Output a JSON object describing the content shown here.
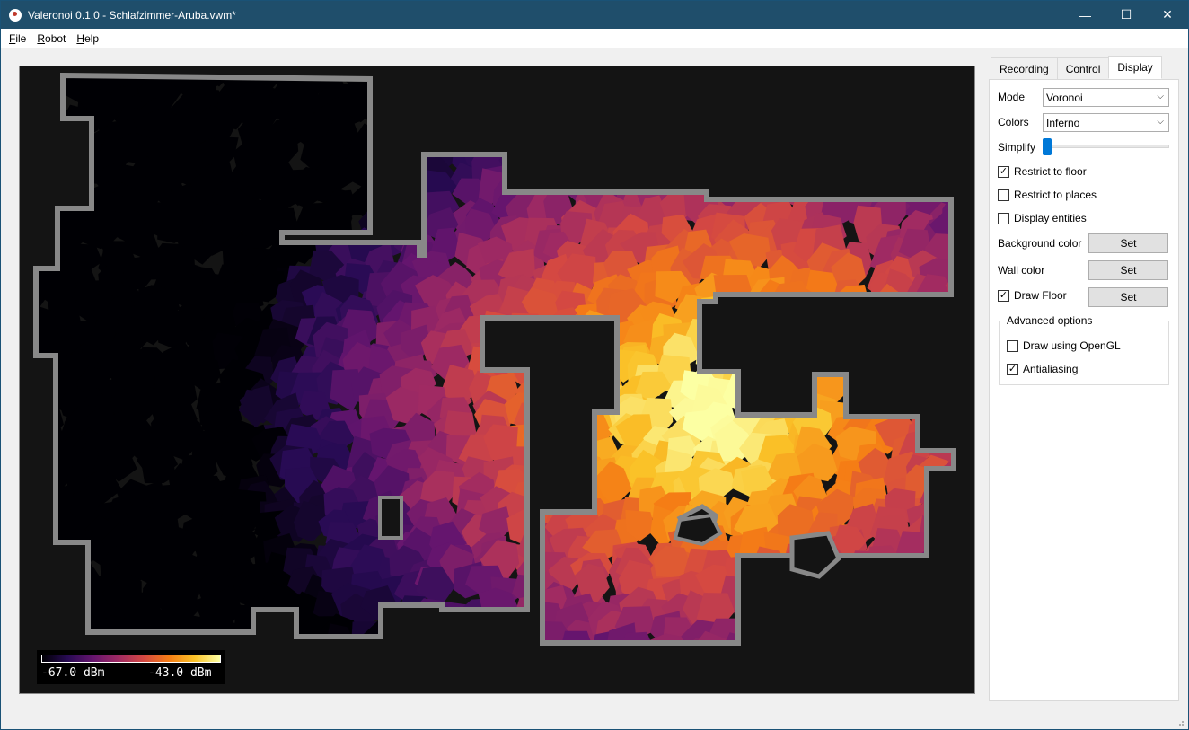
{
  "window": {
    "title": "Valeronoi 0.1.0 - Schlafzimmer-Aruba.vwm*",
    "minimize_glyph": "—",
    "maximize_glyph": "☐",
    "close_glyph": "✕"
  },
  "menu": {
    "items": [
      {
        "label": "File",
        "accel": "F",
        "rest": "ile"
      },
      {
        "label": "Robot",
        "accel": "R",
        "rest": "obot"
      },
      {
        "label": "Help",
        "accel": "H",
        "rest": "elp"
      }
    ]
  },
  "legend": {
    "min_label": "-67.0 dBm",
    "max_label": "-43.0 dBm",
    "colormap": [
      "#000004",
      "#280b54",
      "#65156e",
      "#9f2a63",
      "#d44842",
      "#f57d15",
      "#fac228",
      "#fcffa4"
    ]
  },
  "colors": {
    "background": "#141414",
    "wall": "#888888",
    "titlebar": "#1f4e6b",
    "accent": "#0078d7"
  },
  "tabs": [
    {
      "label": "Recording",
      "active": false
    },
    {
      "label": "Control",
      "active": false
    },
    {
      "label": "Display",
      "active": true
    }
  ],
  "display": {
    "mode_label": "Mode",
    "mode_value": "Voronoi",
    "colors_label": "Colors",
    "colors_value": "Inferno",
    "simplify_label": "Simplify",
    "simplify_value": 0,
    "restrict_floor_label": "Restrict to floor",
    "restrict_floor_checked": true,
    "restrict_places_label": "Restrict to places",
    "restrict_places_checked": false,
    "display_entities_label": "Display entities",
    "display_entities_checked": false,
    "background_color_label": "Background color",
    "background_color_button": "Set",
    "wall_color_label": "Wall color",
    "wall_color_button": "Set",
    "draw_floor_label": "Draw Floor",
    "draw_floor_checked": true,
    "draw_floor_button": "Set",
    "advanced_title": "Advanced options",
    "opengl_label": "Draw using OpenGL",
    "opengl_checked": false,
    "antialiasing_label": "Antialiasing",
    "antialiasing_checked": true
  }
}
